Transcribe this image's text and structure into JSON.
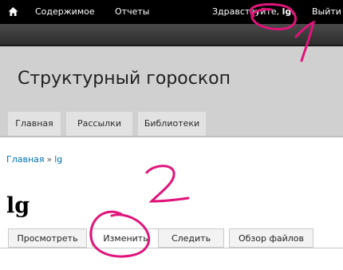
{
  "toolbar": {
    "home_icon": "home-icon",
    "content_label": "Содержимое",
    "reports_label": "Отчеты",
    "greeting_prefix": "Здравствуйте, ",
    "username": "lg",
    "greeting_suffix": ".",
    "logout_label": "Выйти"
  },
  "header": {
    "site_name": "Структурный гороскоп",
    "tabs": [
      {
        "label": "Главная"
      },
      {
        "label": "Рассылки"
      },
      {
        "label": "Библиотеки"
      }
    ]
  },
  "breadcrumb": {
    "home": "Главная",
    "separator": "»",
    "current": "lg"
  },
  "page": {
    "title": "lg",
    "tabs": [
      {
        "label": "Просмотреть"
      },
      {
        "label": "Изменить"
      },
      {
        "label": "Следить"
      },
      {
        "label": "Обзор файлов"
      }
    ]
  },
  "annotations": {
    "color": "#e0147a",
    "marks": [
      {
        "label": "1"
      },
      {
        "label": "2"
      }
    ]
  }
}
